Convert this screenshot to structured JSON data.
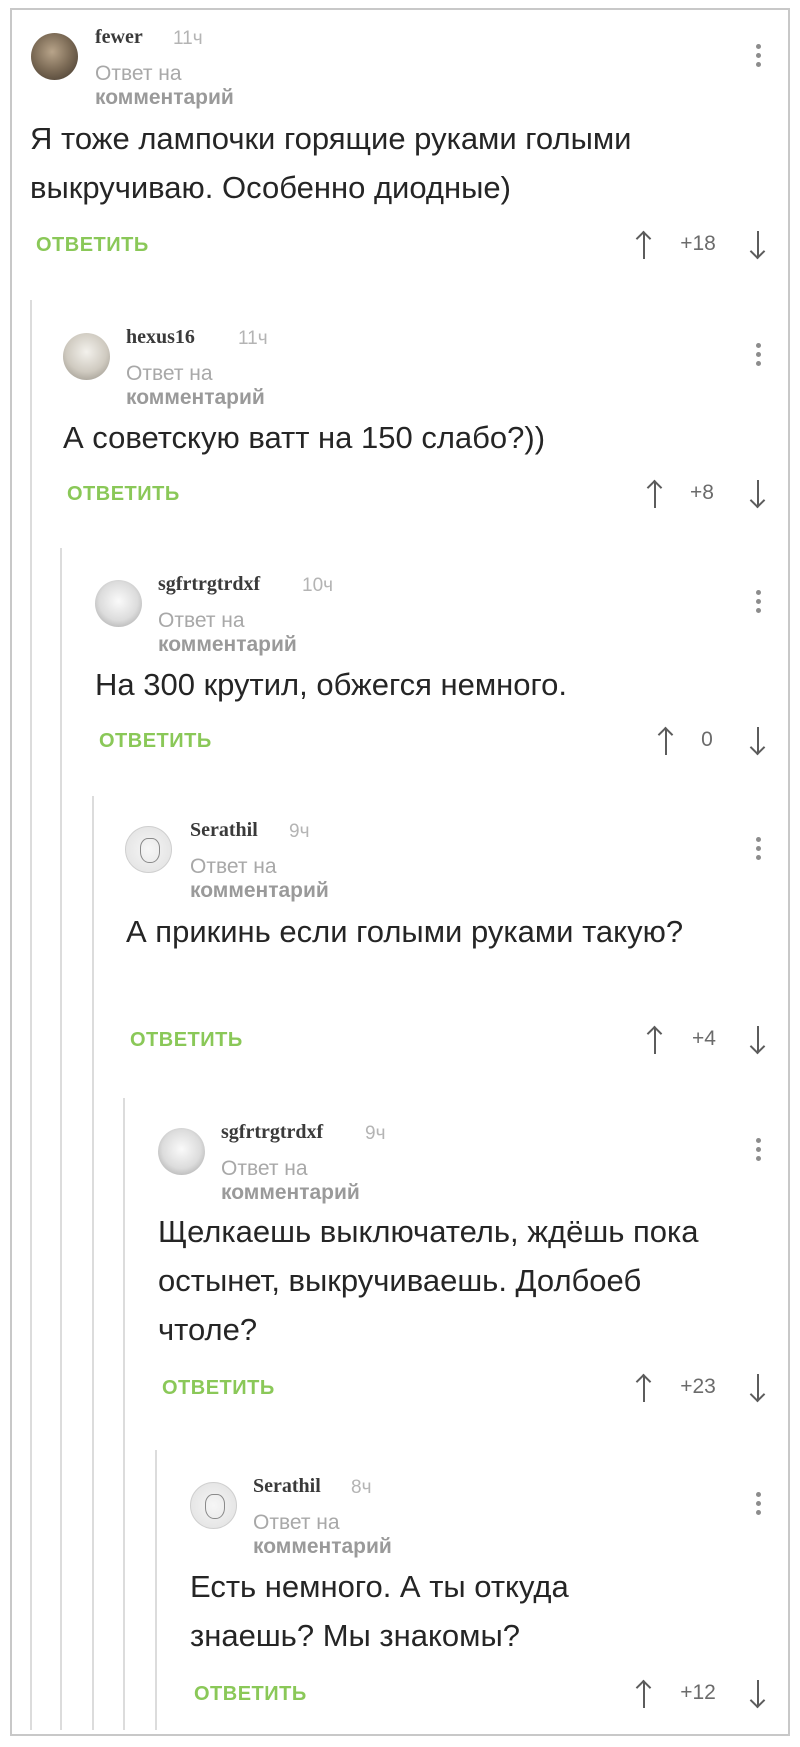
{
  "ui": {
    "reply_to_prefix": "Ответ на",
    "reply_to_target": "комментарий",
    "reply_label": "ОТВЕТИТЬ"
  },
  "comments": [
    {
      "author": "fewer",
      "time": "11ч",
      "text": "Я тоже лампочки горящие руками голыми выкручиваю. Особенно диодные)",
      "score": "+18",
      "avatar": "owl-avatar"
    },
    {
      "author": "hexus16",
      "time": "11ч",
      "text": "А советскую ватт на 150 слабо?))",
      "score": "+8",
      "avatar": "cat-avatar"
    },
    {
      "author": "sgfrtrgtrdxf",
      "time": "10ч",
      "text": "На 300 крутил, обжегся немного.",
      "score": "0",
      "avatar": "kitten-avatar"
    },
    {
      "author": "Serathil",
      "time": "9ч",
      "text": "А прикинь если голыми руками такую?",
      "score": "+4",
      "avatar": "sketch-avatar"
    },
    {
      "author": "sgfrtrgtrdxf",
      "time": "9ч",
      "text": "Щелкаешь выключатель, ждёшь пока остынет, выкручиваешь. Долбоеб чтоле?",
      "score": "+23",
      "avatar": "kitten-avatar"
    },
    {
      "author": "Serathil",
      "time": "8ч",
      "text": "Есть немного. А ты откуда знаешь? Мы знакомы?",
      "score": "+12",
      "avatar": "sketch-avatar"
    }
  ]
}
